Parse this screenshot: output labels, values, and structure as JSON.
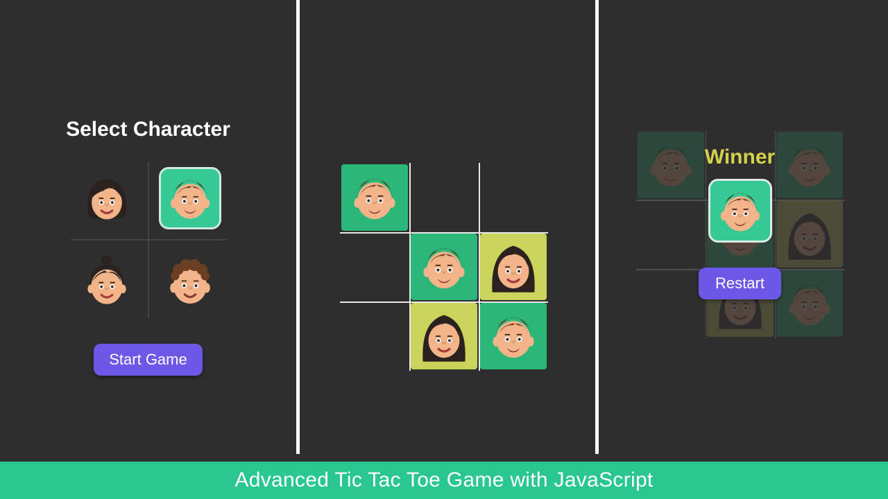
{
  "footer": {
    "title": "Advanced Tic Tac Toe Game with JavaScript"
  },
  "colors": {
    "accent_green": "#2ac78e",
    "tile_green": "#37c993",
    "tile_olive": "#cad45a",
    "button_purple": "#6b58e6",
    "bg_dark": "#2e2e2e",
    "winner_yellow": "#d3d24a"
  },
  "selectScreen": {
    "title": "Select Character",
    "startLabel": "Start Game",
    "characters": [
      {
        "id": "woman-short-bob",
        "selected": false
      },
      {
        "id": "man-short-brown",
        "selected": true
      },
      {
        "id": "woman-bun",
        "selected": false
      },
      {
        "id": "man-curly-brown",
        "selected": false
      }
    ]
  },
  "boardScreen": {
    "currentTurn": "p1",
    "players": {
      "p1": {
        "character": "man-short-brown",
        "tileColor": "#2bb778"
      },
      "p2": {
        "character": "woman-long-dark",
        "tileColor": "#cad45a"
      }
    },
    "cells": [
      [
        "p1",
        null,
        null
      ],
      [
        null,
        "p1",
        "p2"
      ],
      [
        null,
        "p2",
        "p1"
      ]
    ]
  },
  "winnerScreen": {
    "title": "Winner",
    "winnerCharacter": "man-short-brown",
    "restartLabel": "Restart",
    "backgroundBoardCells": [
      [
        "p1",
        null,
        "p1"
      ],
      [
        null,
        "p1",
        "p2"
      ],
      [
        null,
        "p2",
        "p1"
      ]
    ]
  }
}
